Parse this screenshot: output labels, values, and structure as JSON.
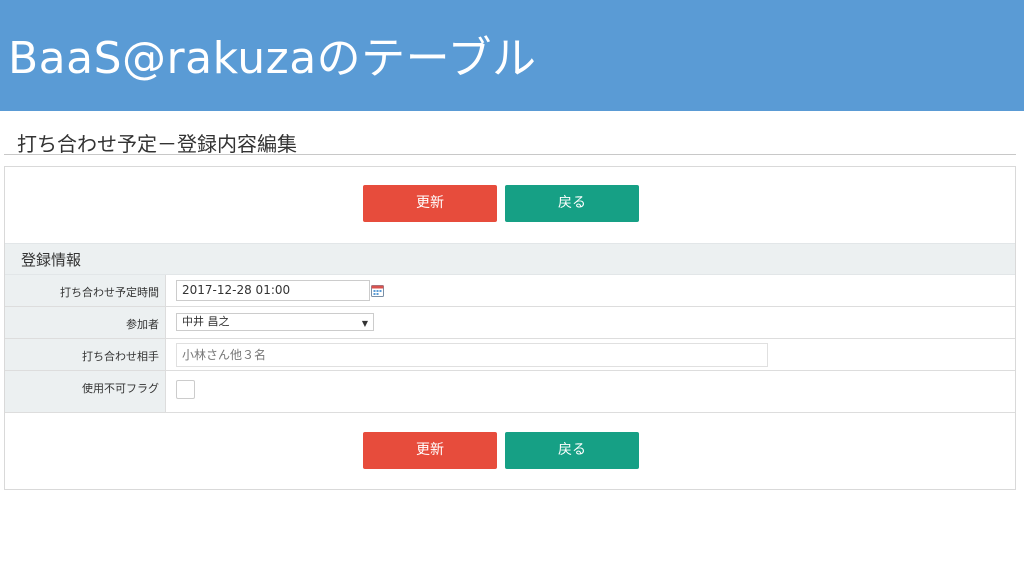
{
  "banner": {
    "title": "BaaS@rakuzaのテーブル"
  },
  "page": {
    "title": "打ち合わせ予定－登録内容編集"
  },
  "buttons": {
    "update_label": "更新",
    "back_label": "戻る"
  },
  "section": {
    "title": "登録情報"
  },
  "form": {
    "meeting_time": {
      "label": "打ち合わせ予定時間",
      "value": "2017-12-28 01:00"
    },
    "participant": {
      "label": "参加者",
      "value": "中井 昌之"
    },
    "counterpart": {
      "label": "打ち合わせ相手",
      "value": "小林さん他３名"
    },
    "disabled_flag": {
      "label": "使用不可フラグ",
      "checked": false
    }
  },
  "colors": {
    "banner": "#5a9bd5",
    "update_button": "#e74c3c",
    "back_button": "#16a085",
    "section_bg": "#ecf0f1"
  },
  "icons": {
    "calendar": "calendar-icon",
    "dropdown": "chevron-down-icon"
  }
}
